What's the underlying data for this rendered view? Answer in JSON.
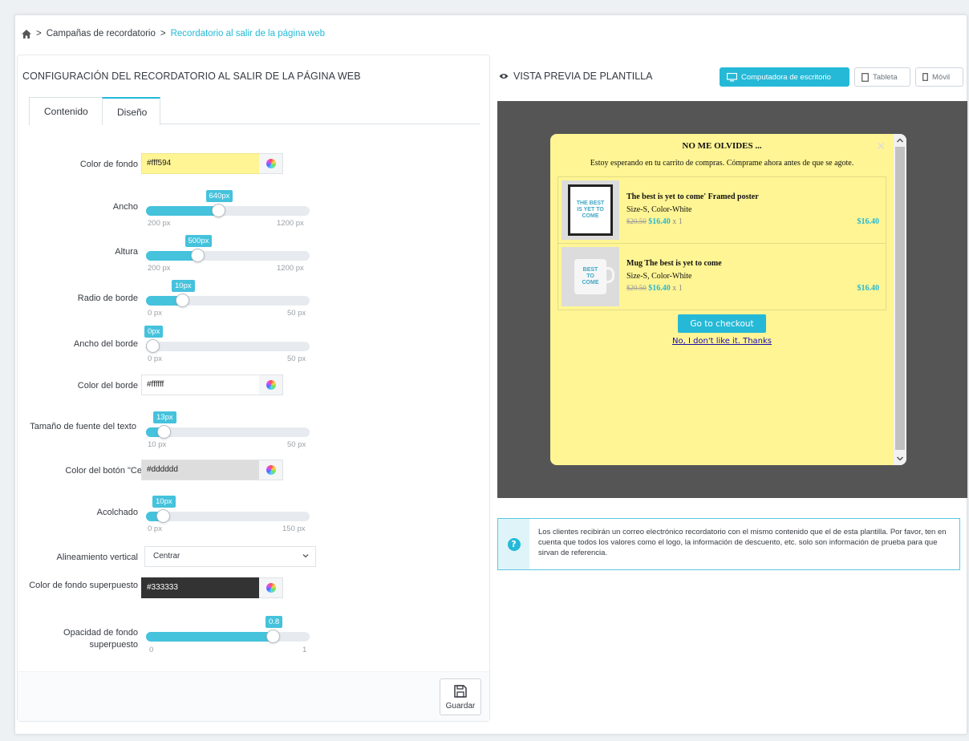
{
  "breadcrumb": {
    "separator": ">",
    "items": [
      "Campañas de recordatorio",
      "Recordatorio al salir de la página web"
    ]
  },
  "left_panel": {
    "title": "CONFIGURACIÓN DEL RECORDATORIO AL SALIR DE LA PÁGINA WEB",
    "tabs": [
      "Contenido",
      "Diseño"
    ],
    "active_tab": "Diseño",
    "fields": {
      "bg_color": {
        "label": "Color de fondo",
        "value": "#fff594"
      },
      "width": {
        "label": "Ancho",
        "value": "640px",
        "min": "200 px",
        "max": "1200 px",
        "fraction": 0.44
      },
      "height": {
        "label": "Altura",
        "value": "500px",
        "min": "200 px",
        "max": "1200 px",
        "fraction": 0.3
      },
      "border_radius": {
        "label": "Radio de borde",
        "value": "10px",
        "min": "0 px",
        "max": "50 px",
        "fraction": 0.2
      },
      "border_width": {
        "label": "Ancho del borde",
        "value": "0px",
        "min": "0 px",
        "max": "50 px",
        "fraction": 0.0
      },
      "border_color": {
        "label": "Color del borde",
        "value": "#ffffff"
      },
      "font_size": {
        "label": "Tamaño de fuente del texto",
        "value": "13px",
        "min": "10 px",
        "max": "50 px",
        "fraction": 0.075
      },
      "close_color": {
        "label": "Color del botón \"Cerrar\"",
        "value": "#dddddd"
      },
      "padding": {
        "label": "Acolchado",
        "value": "10px",
        "min": "0 px",
        "max": "150 px",
        "fraction": 0.067
      },
      "vertical_align": {
        "label": "Alineamiento vertical",
        "value": "Centrar"
      },
      "overlay_color": {
        "label": "Color de fondo superpuesto",
        "value": "#333333"
      },
      "overlay_opacity": {
        "label": "Opacidad de fondo superpuesto",
        "value": "0.8",
        "min": "0",
        "max": "1",
        "fraction": 0.8
      }
    },
    "save_label": "Guardar"
  },
  "preview": {
    "title": "VISTA PREVIA DE PLANTILLA",
    "devices": [
      "Computadora de escritorio",
      "Tableta",
      "Móvil"
    ],
    "active_device": "Computadora de escritorio",
    "popup": {
      "title": "NO ME OLVIDES ...",
      "close_symbol": "✕",
      "message": "Estoy esperando en tu carrito de compras. Cómprame ahora antes de que se agote.",
      "products": [
        {
          "name": "The best is yet to come' Framed poster",
          "attributes": "Size-S, Color-White",
          "old_price": "$20.50",
          "price": "$16.40",
          "qty": "x 1",
          "total": "$16.40",
          "image_text": "THE BEST IS YET TO COME"
        },
        {
          "name": "Mug The best is yet to come",
          "attributes": "Size-S, Color-White",
          "old_price": "$20.50",
          "price": "$16.40",
          "qty": "x 1",
          "total": "$16.40",
          "image_text": "BEST TO COME"
        }
      ],
      "checkout_label": "Go to checkout",
      "decline_label": "No, I don't like it. Thanks"
    },
    "info": "Los clientes recibirán un correo electrónico recordatorio con el mismo contenido que el de esta plantilla. Por favor, ten en cuenta que todos los valores como el logo, la información de descuento, etc. solo son información de prueba para que sirvan de referencia."
  },
  "colors": {
    "accent": "#25b9d7",
    "popup_bg": "#fff594",
    "overlay": "#555555"
  }
}
